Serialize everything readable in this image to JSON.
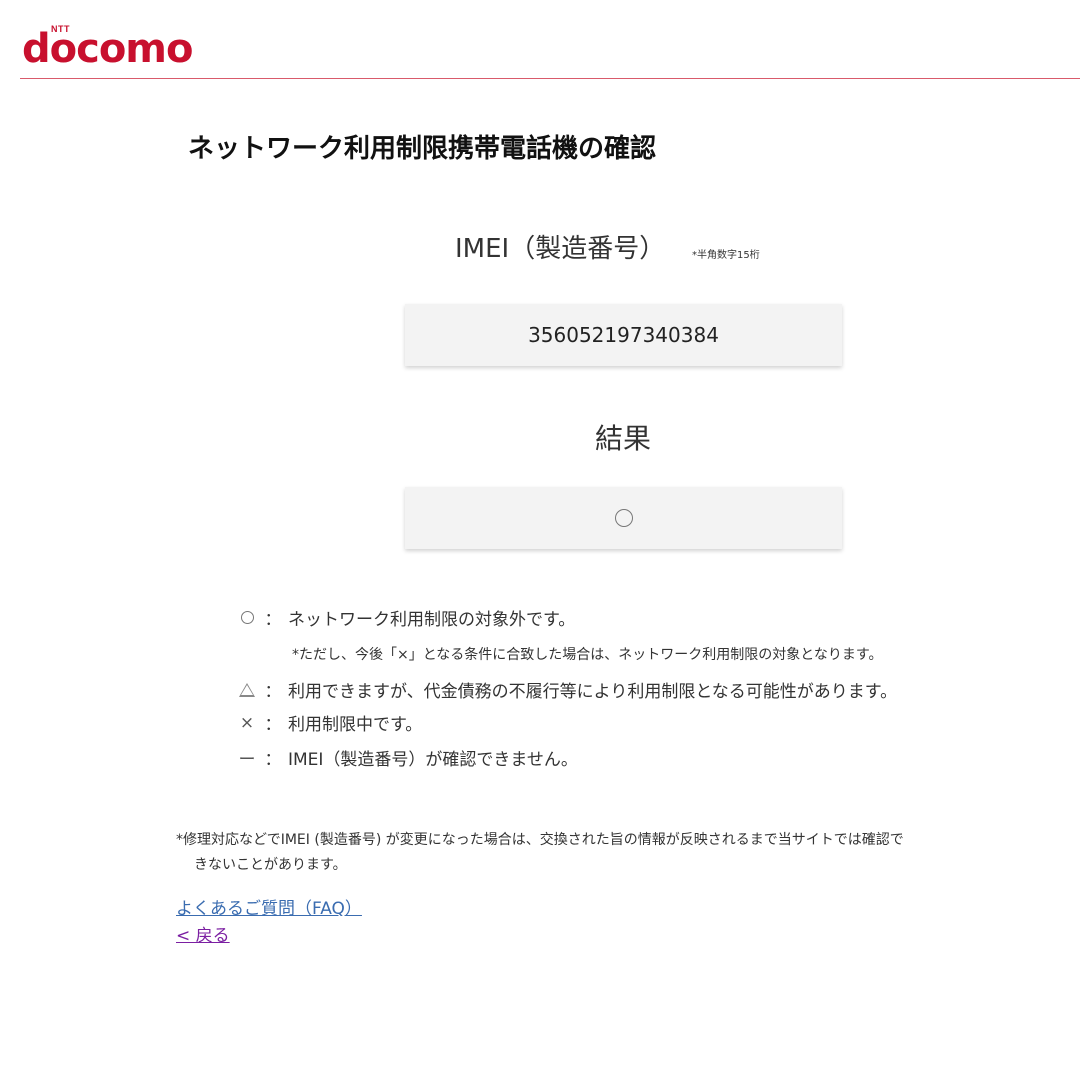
{
  "header": {
    "logo_small": "NTT",
    "logo_text": "docomo",
    "brand_color": "#c8102e"
  },
  "page": {
    "title": "ネットワーク利用制限携帯電話機の確認"
  },
  "imei": {
    "label": "IMEI（製造番号）",
    "note": "*半角数字15桁",
    "value": "356052197340384"
  },
  "result": {
    "label": "結果",
    "value_symbol": "circle-icon"
  },
  "legend": {
    "items": [
      {
        "symbol": "circle-icon",
        "colon": "：",
        "text": "ネットワーク利用制限の対象外です。"
      },
      {
        "symbol": "triangle-icon",
        "colon": "：",
        "text": "利用できますが、代金債務の不履行等により利用制限となる可能性があります。"
      },
      {
        "symbol": "×",
        "colon": "：",
        "text": "利用制限中です。"
      },
      {
        "symbol": "ー",
        "colon": "：",
        "text": "IMEI（製造番号）が確認できません。"
      }
    ],
    "circle_note": "*ただし、今後「×」となる条件に合致した場合は、ネットワーク利用制限の対象となります。"
  },
  "footnote": {
    "line1": "*修理対応などでIMEI (製造番号) が変更になった場合は、交換された旨の情報が反映されるまで当サイトでは確認で",
    "line2": "きないことがあります。"
  },
  "links": {
    "faq": "よくあるご質問（FAQ）",
    "back": "< 戻る"
  }
}
